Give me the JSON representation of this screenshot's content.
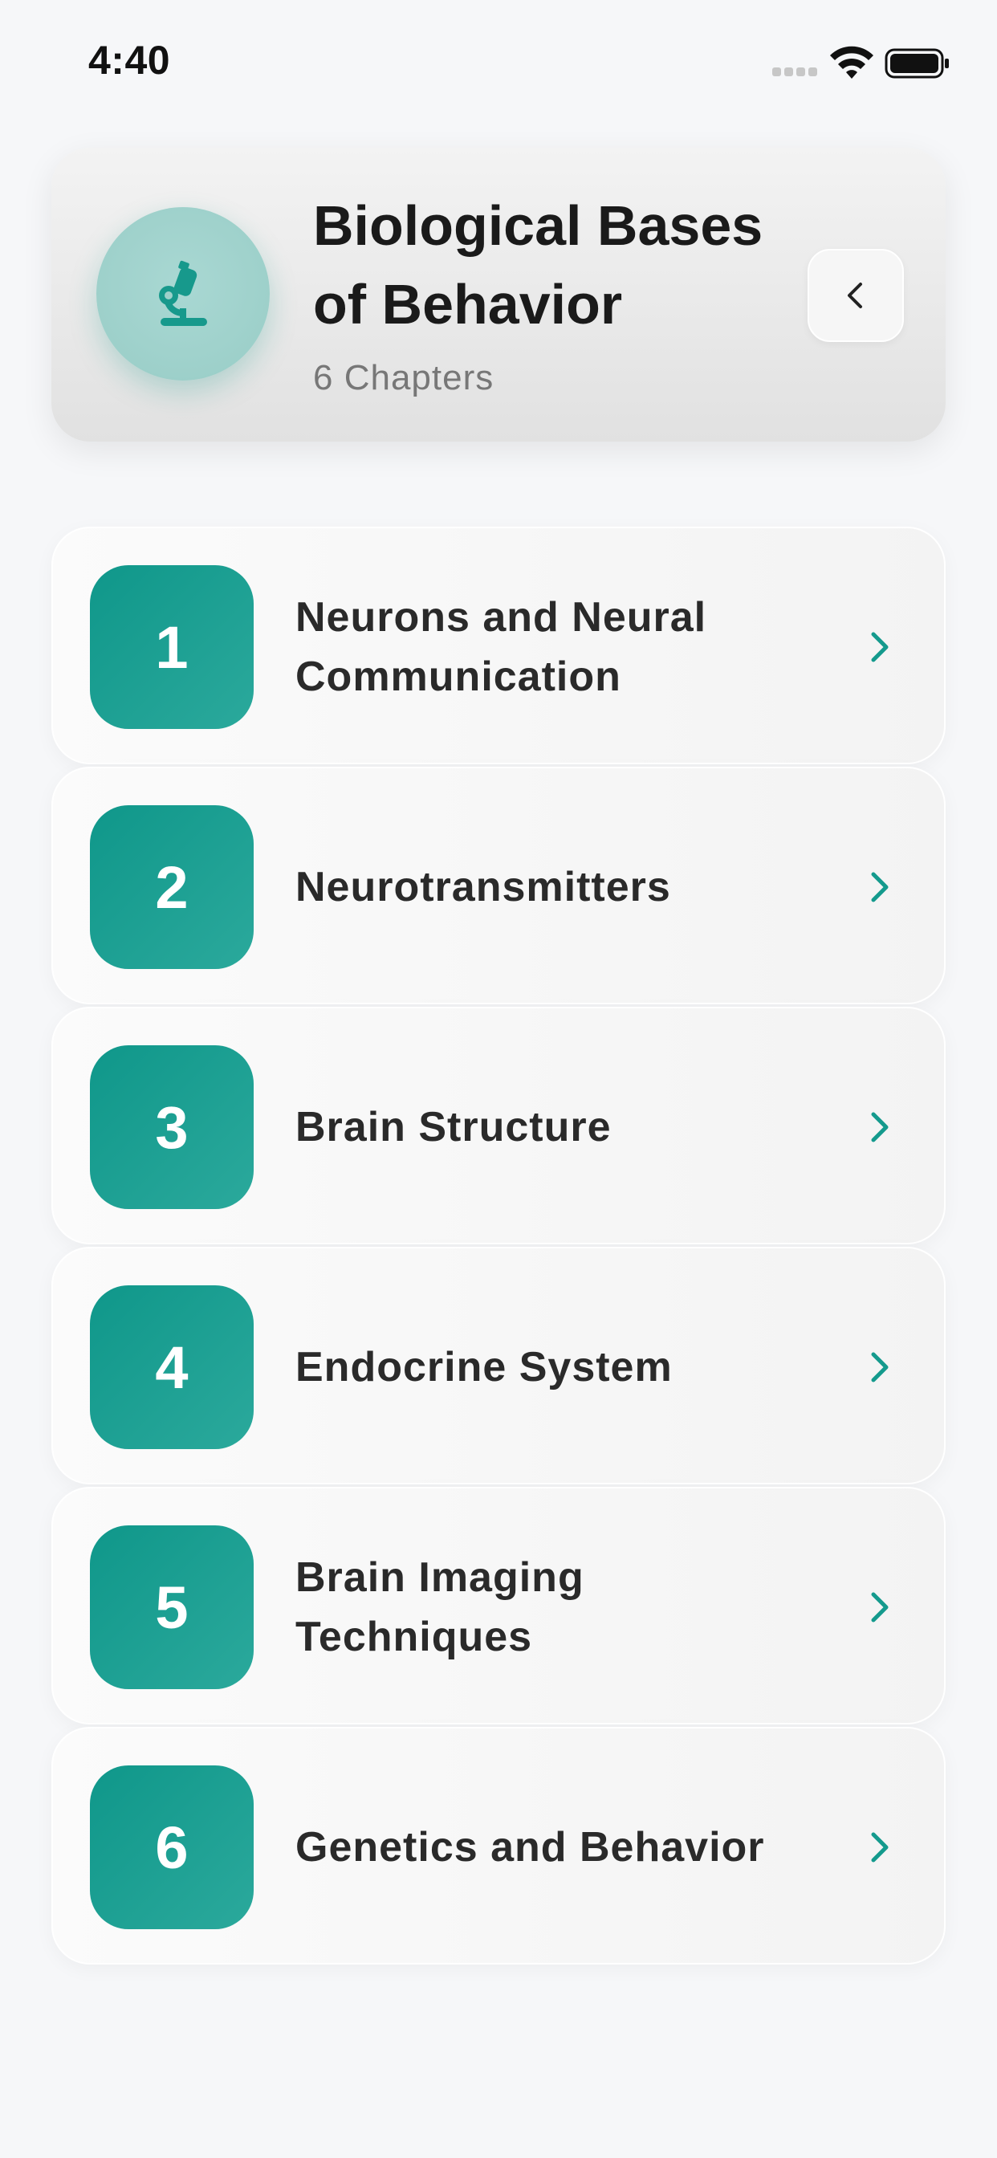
{
  "status_bar": {
    "time": "4:40",
    "icons": [
      "signal-icon",
      "wifi-icon",
      "battery-icon"
    ]
  },
  "header": {
    "title": "Biological Bases of Behavior",
    "subtitle": "6 Chapters",
    "icon": "microscope-icon",
    "back_icon": "chevron-left-icon"
  },
  "chapters": [
    {
      "number": "1",
      "title": "Neurons and Neural Communication"
    },
    {
      "number": "2",
      "title": "Neurotransmitters"
    },
    {
      "number": "3",
      "title": "Brain Structure"
    },
    {
      "number": "4",
      "title": "Endocrine System"
    },
    {
      "number": "5",
      "title": "Brain Imaging Techniques"
    },
    {
      "number": "6",
      "title": "Genetics and Behavior"
    }
  ],
  "colors": {
    "accent": "#149a8d",
    "background": "#f6f7f9",
    "title_text": "#1a1a1a",
    "subtitle_text": "#777777"
  }
}
